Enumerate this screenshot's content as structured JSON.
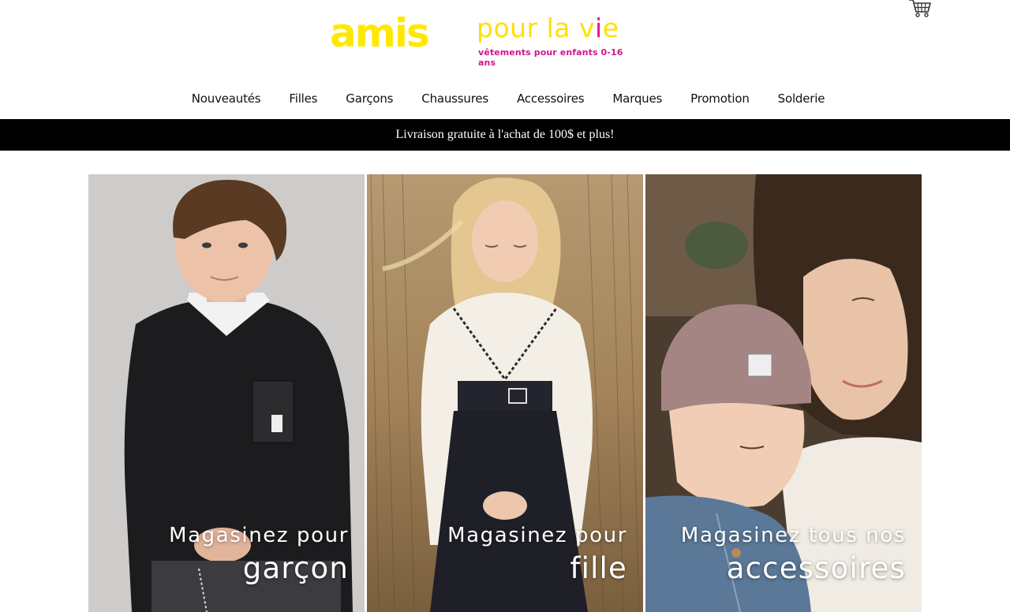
{
  "header": {
    "logo_mark": "amis",
    "logo_word_pre": "pour la v",
    "logo_word_i": "i",
    "logo_word_post": "e",
    "logo_tagline": "vêtements pour enfants 0-16 ans",
    "cart_icon": "shopping-cart-icon"
  },
  "nav": {
    "items": [
      {
        "label": "Nouveautés"
      },
      {
        "label": "Filles"
      },
      {
        "label": "Garçons"
      },
      {
        "label": "Chaussures"
      },
      {
        "label": "Accessoires"
      },
      {
        "label": "Marques"
      },
      {
        "label": "Promotion"
      },
      {
        "label": "Solderie"
      }
    ]
  },
  "banner": {
    "text": "Livraison gratuite à l'achat de 100$ et plus!"
  },
  "tiles": [
    {
      "line1": "Magasinez pour",
      "line2": "garçon"
    },
    {
      "line1": "Magasinez pour",
      "line2": "fille"
    },
    {
      "line1": "Magasinez tous nos",
      "line2": "accessoires"
    }
  ],
  "colors": {
    "logo_yellow": "#ffe800",
    "logo_pink": "#e8168a",
    "banner_bg": "#000000",
    "banner_text": "#ffffff"
  }
}
